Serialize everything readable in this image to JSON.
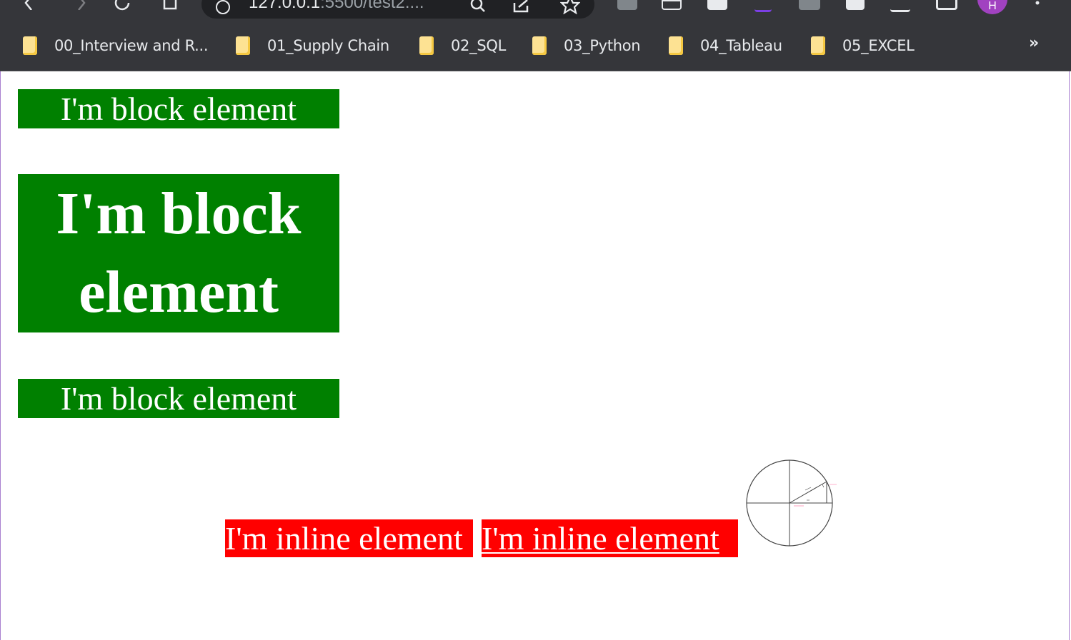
{
  "browser": {
    "url_host": "127.0.0.1",
    "url_path": ":5500/test2....",
    "profile_initial": "H",
    "bookmarks": [
      {
        "label": "00_Interview and R..."
      },
      {
        "label": "01_Supply Chain"
      },
      {
        "label": "02_SQL"
      },
      {
        "label": "03_Python"
      },
      {
        "label": "04_Tableau"
      },
      {
        "label": "05_EXCEL"
      }
    ],
    "bookmarks_overflow": "»"
  },
  "page": {
    "block_elements": [
      {
        "text": "I'm block element"
      },
      {
        "text": "I'm block element"
      },
      {
        "text": "I'm block element"
      }
    ],
    "inline_elements": [
      {
        "text": "I'm inline element"
      },
      {
        "text": "I'm inline element"
      }
    ],
    "colors": {
      "block_bg": "#008000",
      "inline_bg": "#ff0000",
      "text": "#ffffff"
    }
  }
}
